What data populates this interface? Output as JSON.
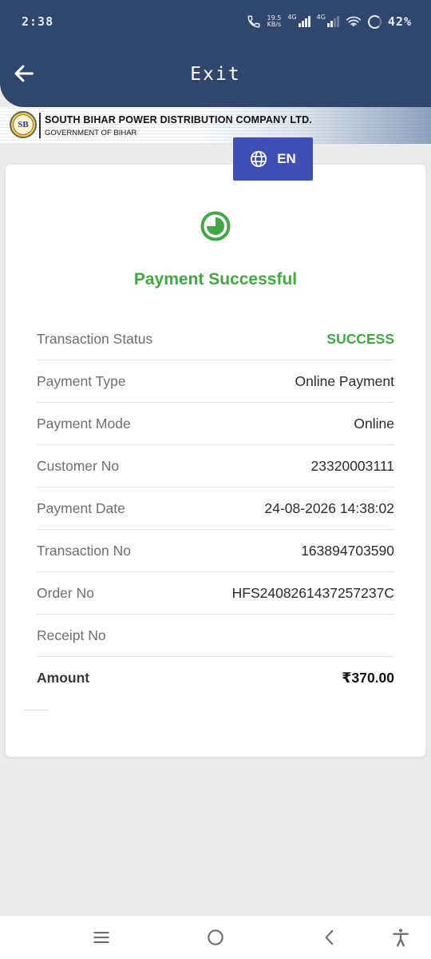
{
  "status_bar": {
    "time": "2:38",
    "net_speed_value": "19.5",
    "net_speed_unit": "KB/s",
    "network1": "4G",
    "network2": "4G",
    "battery": "42%"
  },
  "app_bar": {
    "title": "Exit"
  },
  "banner": {
    "logo_text": "SB",
    "company_name": "SOUTH BIHAR POWER DISTRIBUTION COMPANY LTD.",
    "government": "GOVERNMENT OF BIHAR"
  },
  "language": {
    "label": "EN"
  },
  "receipt": {
    "heading": "Payment Successful",
    "rows": [
      {
        "label": "Transaction Status",
        "value": "SUCCESS"
      },
      {
        "label": "Payment Type",
        "value": "Online Payment"
      },
      {
        "label": "Payment Mode",
        "value": "Online"
      },
      {
        "label": "Customer No",
        "value": "23320003111"
      },
      {
        "label": "Payment Date",
        "value": "24-08-2026 14:38:02"
      },
      {
        "label": "Transaction No",
        "value": "163894703590"
      },
      {
        "label": "Order No",
        "value": "HFS2408261437257237C"
      },
      {
        "label": "Receipt No",
        "value": ""
      },
      {
        "label": "Amount",
        "value": "₹370.00"
      }
    ]
  },
  "colors": {
    "header_bg": "#30476b",
    "success_green": "#43a843",
    "language_button": "#3e4fb6",
    "page_bg": "#ebebeb"
  },
  "icons": {
    "back": "arrow-left-icon",
    "language": "globe-icon",
    "success": "success-icon",
    "nav_recents": "menu-lines-icon",
    "nav_home": "circle-home-icon",
    "nav_back": "chevron-left-icon",
    "nav_accessibility": "accessibility-icon"
  }
}
